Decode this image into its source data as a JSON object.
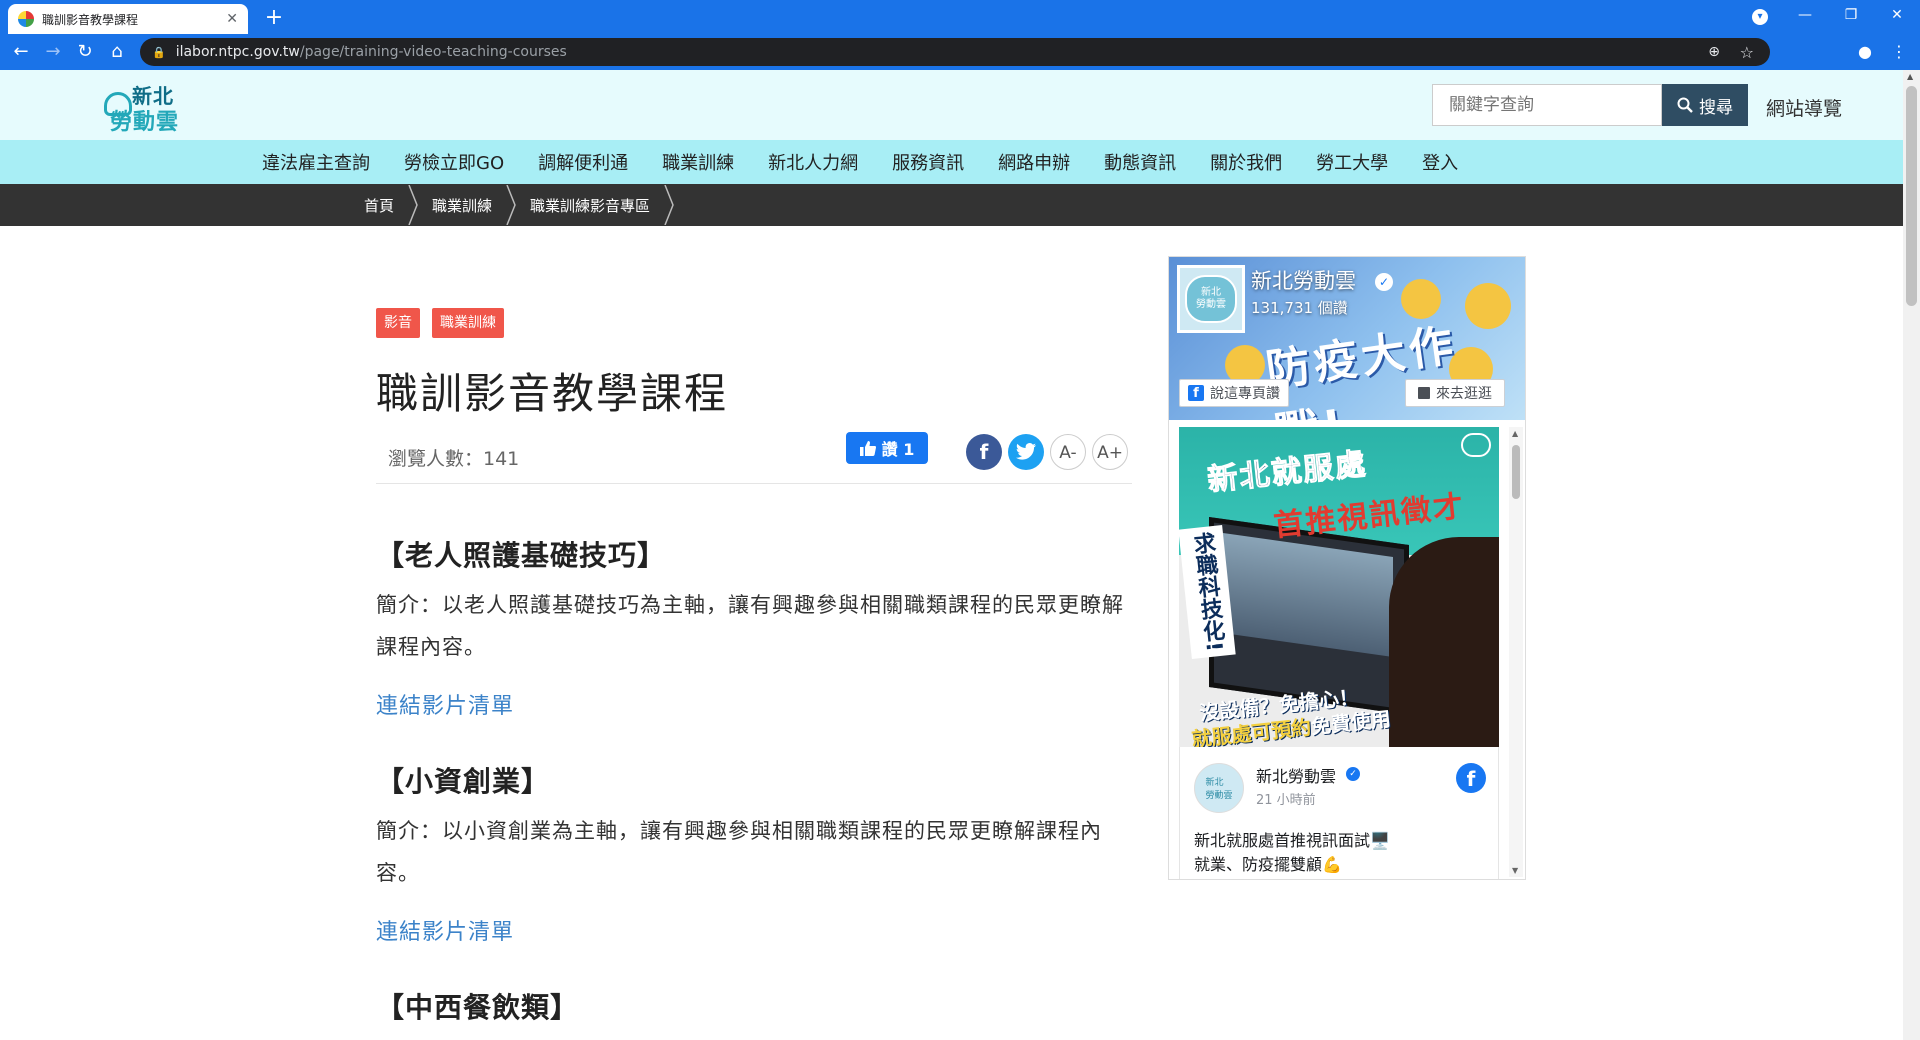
{
  "browser": {
    "tab_title": "職訓影音教學課程",
    "tab_close": "✕",
    "new_tab": "+",
    "url_host": "ilabor.ntpc.gov.tw",
    "url_path": "/page/training-video-teaching-courses"
  },
  "header": {
    "logo_line1": "新北",
    "logo_line2": "勞動雲",
    "search_placeholder": "關鍵字查詢",
    "search_button": "搜尋",
    "sitemap": "網站導覽"
  },
  "nav": {
    "items": [
      "違法雇主查詢",
      "勞檢立即GO",
      "調解便利通",
      "職業訓練",
      "新北人力網",
      "服務資訊",
      "網路申辦",
      "動態資訊",
      "關於我們",
      "勞工大學",
      "登入"
    ]
  },
  "breadcrumb": {
    "items": [
      "首頁",
      "職業訓練",
      "職業訓練影音專區"
    ]
  },
  "article": {
    "tags": [
      "影音",
      "職業訓練"
    ],
    "title": "職訓影音教學課程",
    "views": "瀏覽人數：141",
    "like_label": "讚 1",
    "share_fb": "f",
    "font_small": "A-",
    "font_large": "A+",
    "sections": [
      {
        "heading": "【老人照護基礎技巧】",
        "intro": "簡介：以老人照護基礎技巧為主軸，讓有興趣參與相關職類課程的民眾更瞭解課程內容。",
        "link": "連結影片清單"
      },
      {
        "heading": "【小資創業】",
        "intro": "簡介：以小資創業為主軸，讓有興趣參與相關職類課程的民眾更瞭解課程內容。",
        "link": "連結影片清單"
      },
      {
        "heading": "【中西餐飲類】"
      }
    ]
  },
  "facebook": {
    "page_name": "新北勞動雲",
    "likes": "131,731 個讚",
    "cover_text": "防疫大作戰!",
    "avatar_text": "新北\n勞動雲",
    "like_page": "說這專頁讚",
    "shop": "來去逛逛",
    "post_headline1": "新北就服處",
    "post_headline2": "首推視訊徵才",
    "post_vertical": "求職科技化!",
    "post_caption1": "沒設備？免擔心！",
    "post_caption2a": "就服處可預約",
    "post_caption2b": "免費使用",
    "post_author": "新北勞動雲",
    "post_time": "21 小時前",
    "post_text_line1": "新北就服處首推視訊面試🖥️",
    "post_text_line2": "就業、防疫擺雙顧💪"
  }
}
